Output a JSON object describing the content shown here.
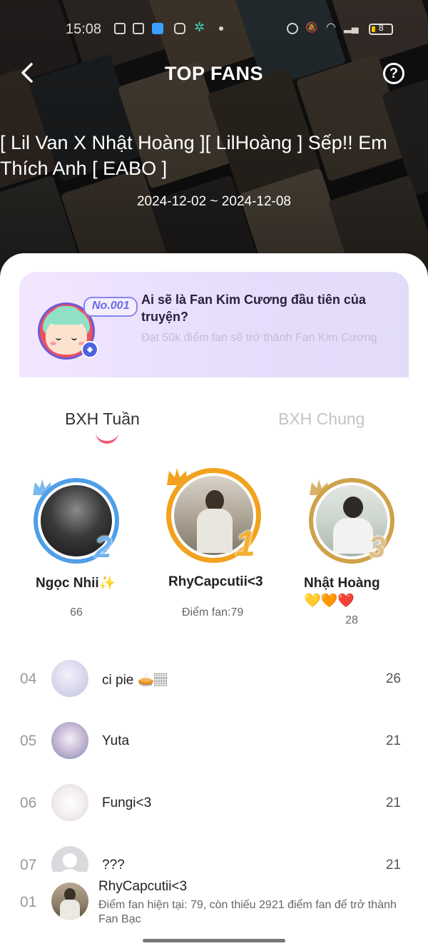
{
  "status_bar": {
    "time": "15:08",
    "battery": "8",
    "icons": [
      "photo-icon",
      "store-icon",
      "app-icon",
      "instagram-icon",
      "sparkle-icon",
      "dot-icon",
      "alarm-icon",
      "mute-icon",
      "wifi-icon",
      "battery-icon"
    ]
  },
  "header": {
    "title": "TOP FANS",
    "back_icon": "chevron-left-icon",
    "help_icon": "help-circle-icon",
    "help_glyph": "?",
    "story_title": "[ Lil Van X Nhật Hoàng ][ LilHoàng ] Sếp!! Em Thích Anh [ EABO ]",
    "date_range": "2024-12-02 ~ 2024-12-08"
  },
  "banner": {
    "badge": "No.001",
    "question": "Ai sẽ là Fan Kim Cương đầu tiên của truyện?",
    "subtitle": "Đạt 50k điểm fan sẽ trở thành Fan Kim Cương",
    "mascot_icon": "mascot-avatar",
    "gem_icon": "diamond-icon"
  },
  "tabs": {
    "weekly": "BXH Tuần",
    "overall": "BXH Chung",
    "active": "weekly"
  },
  "podium": {
    "first": {
      "rank": "1",
      "name": "RhyCapcutii<3",
      "points": "Điểm fan:79"
    },
    "second": {
      "rank": "2",
      "name": "Ngọc Nhii✨",
      "points": "66"
    },
    "third": {
      "rank": "3",
      "name": "Nhật Hoàng 💛🧡❤️",
      "points": "28"
    }
  },
  "list": [
    {
      "rank": "04",
      "name": "ci pie 🥧🏽",
      "points": "26"
    },
    {
      "rank": "05",
      "name": "Yuta",
      "points": "21"
    },
    {
      "rank": "06",
      "name": "Fungi<3",
      "points": "21"
    },
    {
      "rank": "07",
      "name": "???",
      "points": "21"
    }
  ],
  "my_rank": {
    "rank": "01",
    "name": "RhyCapcutii<3",
    "message": "Điểm fan hiện tại: 79, còn thiếu 2921 điểm fan để trở thành Fan Bạc"
  },
  "colors": {
    "accent": "#ee5a73",
    "gold": "#f2a21e",
    "silver_blue": "#4f9ee8",
    "bronze": "#cfa24a",
    "banner_bg": "#e9defc"
  }
}
